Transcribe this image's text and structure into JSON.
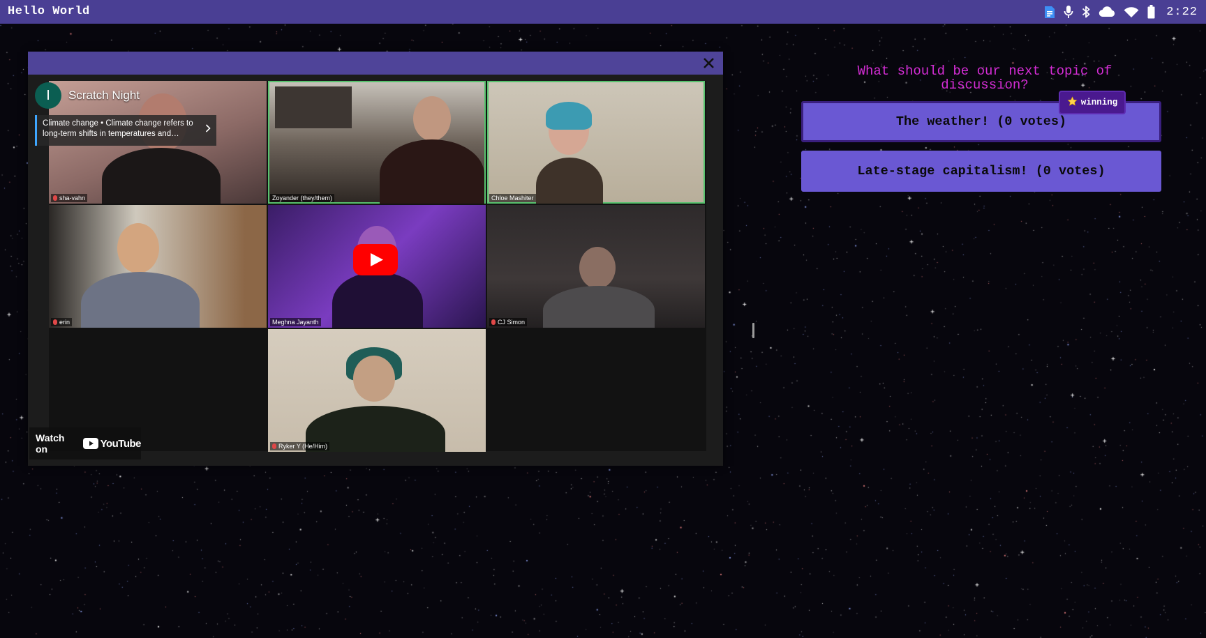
{
  "app": {
    "title": "Hello World"
  },
  "system_tray": {
    "time": "2:22",
    "icons": [
      "document-icon",
      "microphone-icon",
      "bluetooth-icon",
      "cloud-icon",
      "wifi-icon",
      "battery-icon"
    ]
  },
  "video": {
    "channel_initial": "I",
    "channel_title": "Scratch Night",
    "info_card": "Climate change • Climate change refers to long-term shifts in temperatures and…",
    "watch_on_label": "Watch on",
    "youtube_wordmark": "YouTube",
    "participants": [
      {
        "name": "sha-vahn",
        "muted": true
      },
      {
        "name": "Zoyander (they/them)",
        "muted": false
      },
      {
        "name": "Chloe Mashiter",
        "muted": false
      },
      {
        "name": "erin",
        "muted": true
      },
      {
        "name": "Meghna Jayanth",
        "muted": false
      },
      {
        "name": "CJ Simon",
        "muted": true
      },
      {
        "name": "Ryker Y (He/Him)",
        "muted": true
      }
    ]
  },
  "poll": {
    "question": "What should be our next topic of discussion?",
    "badge": "winning",
    "options": [
      {
        "label": "The weather! (0 votes)"
      },
      {
        "label": "Late-stage capitalism! (0 votes)"
      }
    ]
  },
  "colors": {
    "topbar": "#4a3f94",
    "window_bar": "#4f4499",
    "question": "#d62dd6",
    "option": "#6a58d3",
    "badge": "#4a198f",
    "active_speaker": "#58c26e"
  }
}
